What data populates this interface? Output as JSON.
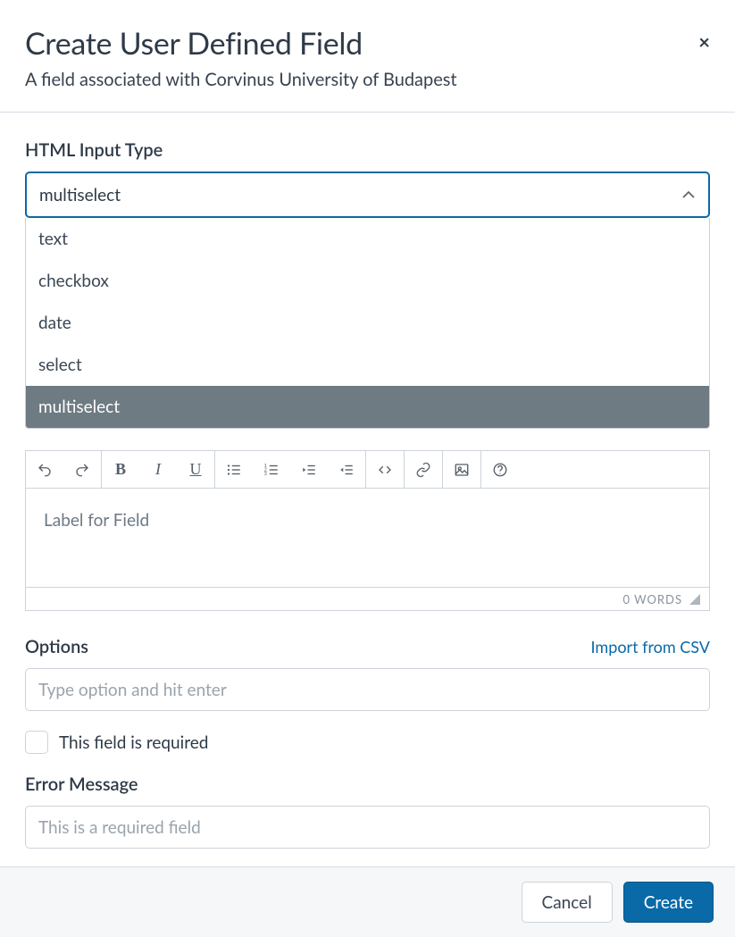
{
  "header": {
    "title": "Create User Defined Field",
    "subtitle": "A field associated with Corvinus University of Budapest",
    "close_icon": "×"
  },
  "input_type": {
    "label": "HTML Input Type",
    "selected": "multiselect",
    "options": [
      "text",
      "checkbox",
      "date",
      "select",
      "multiselect"
    ]
  },
  "editor": {
    "placeholder": "Label for Field",
    "word_count": "0 WORDS",
    "toolbar": {
      "undo": "undo-icon",
      "redo": "redo-icon",
      "bold": "B",
      "italic": "I",
      "underline": "U",
      "ul": "bullet-list-icon",
      "ol": "number-list-icon",
      "indent": "indent-icon",
      "outdent": "outdent-icon",
      "code": "code-icon",
      "link": "link-icon",
      "image": "image-icon",
      "help": "help-icon"
    }
  },
  "options_section": {
    "label": "Options",
    "import_link": "Import from CSV",
    "placeholder": "Type option and hit enter"
  },
  "required": {
    "label": "This field is required",
    "checked": false
  },
  "error_message": {
    "label": "Error Message",
    "placeholder": "This is a required field"
  },
  "footer": {
    "cancel": "Cancel",
    "create": "Create"
  }
}
